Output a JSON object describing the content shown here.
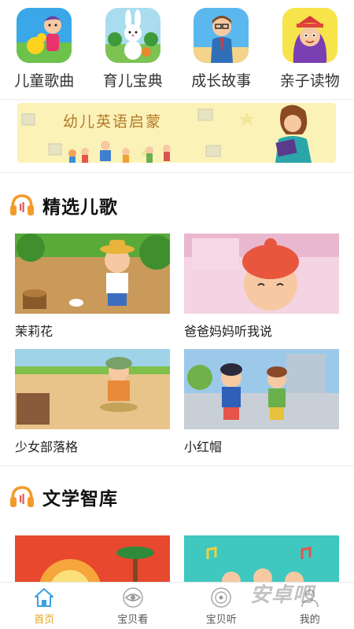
{
  "categories": [
    {
      "label": "儿童歌曲",
      "icon": "duck-kid-icon"
    },
    {
      "label": "育儿宝典",
      "icon": "bunny-icon"
    },
    {
      "label": "成长故事",
      "icon": "teacher-icon"
    },
    {
      "label": "亲子读物",
      "icon": "girl-hat-icon"
    }
  ],
  "banner": {
    "title": "幼儿英语启蒙"
  },
  "sections": [
    {
      "title": "精选儿歌",
      "icon": "headphones-icon",
      "items": [
        {
          "title": "茉莉花"
        },
        {
          "title": "爸爸妈妈听我说"
        },
        {
          "title": "少女部落格"
        },
        {
          "title": "小红帽"
        }
      ]
    },
    {
      "title": "文学智库",
      "icon": "headphones-icon",
      "items": [
        {
          "title": ""
        },
        {
          "title": ""
        }
      ]
    }
  ],
  "nav": [
    {
      "label": "首页",
      "icon": "home-icon",
      "active": true
    },
    {
      "label": "宝贝看",
      "icon": "eye-icon",
      "active": false
    },
    {
      "label": "宝贝听",
      "icon": "disc-icon",
      "active": false
    },
    {
      "label": "我的",
      "icon": "user-icon",
      "active": false
    }
  ],
  "watermark": "安卓吧",
  "colors": {
    "accent": "#e8a41e",
    "headphones": "#f39a2b",
    "banner_bg": "#fbf2b8"
  }
}
